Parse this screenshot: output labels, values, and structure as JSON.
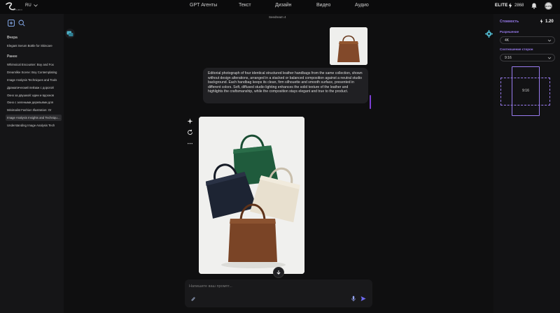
{
  "header": {
    "logo_sub": "STUDIO",
    "language": "RU",
    "nav": [
      "GPT Агенты",
      "Текст",
      "Дизайн",
      "Видео",
      "Аудио"
    ],
    "plan": "ELITE",
    "credits": "2868",
    "avatar_text": "ELITE"
  },
  "sidebar": {
    "yesterday_label": "Вчера",
    "yesterday_items": [
      "Elegant Serum Bottle for Skincare"
    ],
    "earlier_label": "Ранее",
    "earlier_items": [
      "Whimsical Encounter: Boy and Fox",
      "Dreamlike Scene: Boy Contemplating",
      "Image Analysis Techniques and Tools",
      "Драматический пейзаж с дорогой",
      "Окно за двушкой: идеи и вдохнов",
      "Окно с зелеными деревьями для",
      "Minimalist Fashion Illustration: Or",
      "Image Analysis Insights and Techniques",
      "Understanding Image Analysis Tech"
    ],
    "active_index": 7
  },
  "chat": {
    "model": "Seedream 4",
    "prompt": "Editorial photograph of four identical structured leather handbags from the same collection, shown without design alterations, arranged in a stacked or balanced composition against a neutral studio background. Each handbag keeps its clean, firm silhouette and smooth surface, presented in different colors. Soft, diffused studio lighting enhances the solid texture of the leather and highlights the craftsmanship, while the composition stays elegant and true to the product.",
    "input_placeholder": "Напишите ваш промпт..."
  },
  "settings": {
    "cost_label": "Стоимость",
    "cost_value": "1.20",
    "resolution_label": "Разрешение",
    "resolution_value": "4K",
    "aspect_label": "Соотношение сторон",
    "aspect_value": "9:16",
    "aspect_preview": "9:16"
  },
  "colors": {
    "accent": "#9a7cf0",
    "teal_icon": "#4fb3c8",
    "bag_green": "#1f5b3c",
    "bag_navy": "#1d2433",
    "bag_cream": "#e8e0cf",
    "bag_brown": "#7a4426"
  },
  "icons": {
    "new_chat": "new-chat-icon",
    "search": "search-icon",
    "settings": "gear-icon",
    "attach": "paperclip-icon",
    "mic": "microphone-icon",
    "send": "send-icon",
    "download": "download-icon",
    "enhance": "sparkle-icon",
    "regenerate": "refresh-icon",
    "more": "more-icon"
  }
}
